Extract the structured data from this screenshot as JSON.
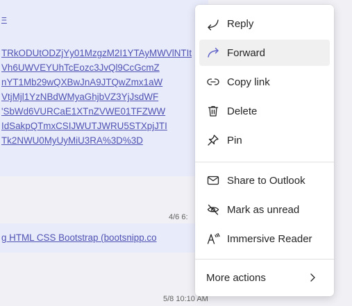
{
  "conversation": {
    "message1": {
      "lines": [
        "=",
        "TRkODUtODZjYy01MzgzM2I1YTAyMWVlNTIt",
        "Vh6UWVEYUhTcEozc3JvQl9CcGcmZ",
        "nYT1Mb29wQXBwJnA9JTQwZmx1aW",
        "VtjMjl1YzNBdWMyaGhjbVZ3YjJsdWF",
        "'SbWd6VURCaE1XTnZVWE01TFZWW",
        "IdSakpQTmxCSIJWUTJWRU5STXpjJTI",
        "Tk2NWU0MyUyMiU3RA%3D%3D"
      ],
      "timestamp": "4/6 6:"
    },
    "message2": {
      "link_text": "g HTML CSS Bootstrap (bootsnipp.co",
      "timestamp": "5/8 10:10 AM"
    }
  },
  "context_menu": {
    "items": [
      {
        "label": "Reply",
        "icon": "reply-icon"
      },
      {
        "label": "Forward",
        "icon": "forward-icon"
      },
      {
        "label": "Copy link",
        "icon": "link-icon"
      },
      {
        "label": "Delete",
        "icon": "trash-icon"
      },
      {
        "label": "Pin",
        "icon": "pin-icon"
      },
      {
        "label": "Share to Outlook",
        "icon": "mail-icon"
      },
      {
        "label": "Mark as unread",
        "icon": "eye-off-icon"
      },
      {
        "label": "Immersive Reader",
        "icon": "immersive-reader-icon"
      },
      {
        "label": "More actions",
        "icon": "chevron-right-icon"
      }
    ]
  },
  "colors": {
    "accent": "#5b5fc7",
    "message_bubble": "#e8ebfa",
    "link": "#4f52b2",
    "highlight": "#f0f0f0"
  }
}
